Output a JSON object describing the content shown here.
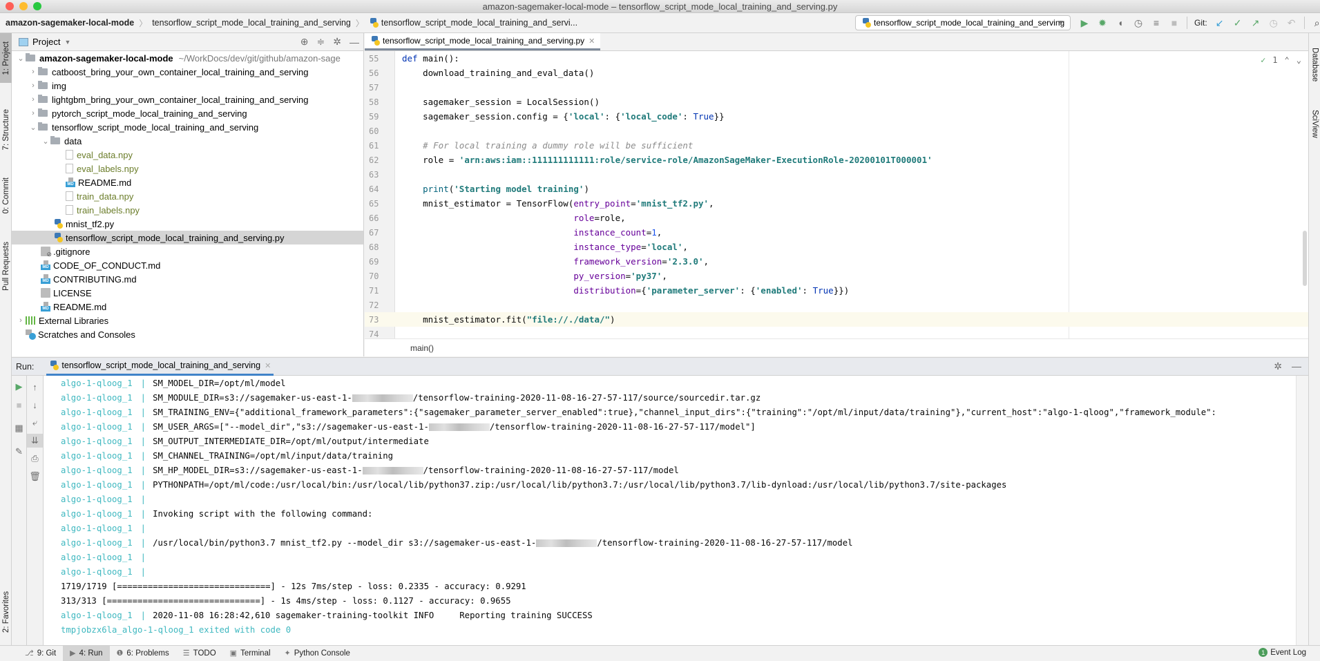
{
  "window": {
    "title": "amazon-sagemaker-local-mode – tensorflow_script_mode_local_training_and_serving.py"
  },
  "navbar": {
    "breadcrumbs": [
      "amazon-sagemaker-local-mode",
      "tensorflow_script_mode_local_training_and_serving",
      "tensorflow_script_mode_local_training_and_servi..."
    ],
    "run_config": "tensorflow_script_mode_local_training_and_serving",
    "git_label": "Git:",
    "icons": [
      "run-icon",
      "debug-icon",
      "coverage-icon",
      "profile-icon",
      "run-with-icon",
      "stop-icon",
      "git-update-icon",
      "git-commit-icon",
      "git-push-icon",
      "git-history-icon",
      "git-rollback-icon",
      "search-icon"
    ]
  },
  "left_strip": {
    "tabs": [
      "1: Project",
      "7: Structure",
      "0: Commit",
      "Pull Requests",
      "2: Favorites"
    ]
  },
  "right_strip": {
    "tabs": [
      "Database",
      "SciView"
    ]
  },
  "project": {
    "title": "Project",
    "root": {
      "name": "amazon-sagemaker-local-mode",
      "path": "~/WorkDocs/dev/git/github/amazon-sage"
    },
    "items": [
      {
        "name": "catboost_bring_your_own_container_local_training_and_serving"
      },
      {
        "name": "img"
      },
      {
        "name": "lightgbm_bring_your_own_container_local_training_and_serving"
      },
      {
        "name": "pytorch_script_mode_local_training_and_serving"
      },
      {
        "name": "tensorflow_script_mode_local_training_and_serving"
      },
      {
        "name": "data"
      },
      {
        "name": "eval_data.npy"
      },
      {
        "name": "eval_labels.npy"
      },
      {
        "name": "README.md"
      },
      {
        "name": "train_data.npy"
      },
      {
        "name": "train_labels.npy"
      },
      {
        "name": "mnist_tf2.py"
      },
      {
        "name": "tensorflow_script_mode_local_training_and_serving.py"
      },
      {
        "name": ".gitignore"
      },
      {
        "name": "CODE_OF_CONDUCT.md"
      },
      {
        "name": "CONTRIBUTING.md"
      },
      {
        "name": "LICENSE"
      },
      {
        "name": "README.md"
      },
      {
        "name": "External Libraries"
      },
      {
        "name": "Scratches and Consoles"
      }
    ]
  },
  "editor": {
    "tab": "tensorflow_script_mode_local_training_and_serving.py",
    "inspection_count": "1",
    "breadcrumb": "main()",
    "lines": [
      {
        "n": "55",
        "t": "def main():"
      },
      {
        "n": "56",
        "t": "    download_training_and_eval_data()"
      },
      {
        "n": "57",
        "t": ""
      },
      {
        "n": "58",
        "t": "    sagemaker_session = LocalSession()"
      },
      {
        "n": "59",
        "t": "    sagemaker_session.config = {'local': {'local_code': True}}"
      },
      {
        "n": "60",
        "t": ""
      },
      {
        "n": "61",
        "t": "    # For local training a dummy role will be sufficient"
      },
      {
        "n": "62",
        "t": "    role = 'arn:aws:iam::111111111111:role/service-role/AmazonSageMaker-ExecutionRole-20200101T000001'"
      },
      {
        "n": "63",
        "t": ""
      },
      {
        "n": "64",
        "t": "    print('Starting model training')"
      },
      {
        "n": "65",
        "t": "    mnist_estimator = TensorFlow(entry_point='mnist_tf2.py',"
      },
      {
        "n": "66",
        "t": "                                 role=role,"
      },
      {
        "n": "67",
        "t": "                                 instance_count=1,"
      },
      {
        "n": "68",
        "t": "                                 instance_type='local',"
      },
      {
        "n": "69",
        "t": "                                 framework_version='2.3.0',"
      },
      {
        "n": "70",
        "t": "                                 py_version='py37',"
      },
      {
        "n": "71",
        "t": "                                 distribution={'parameter_server': {'enabled': True}})"
      },
      {
        "n": "72",
        "t": ""
      },
      {
        "n": "73",
        "t": "    mnist_estimator.fit(\"file://./data/\")"
      },
      {
        "n": "74",
        "t": ""
      }
    ]
  },
  "run": {
    "label": "Run:",
    "tab": "tensorflow_script_mode_local_training_and_serving",
    "host": "algo-1-qloog_1",
    "lines": [
      {
        "host": true,
        "text": "SM_MODEL_DIR=/opt/ml/model"
      },
      {
        "host": true,
        "pre": "SM_MODULE_DIR=s3://sagemaker-us-east-1-",
        "redacted": true,
        "post": "/tensorflow-training-2020-11-08-16-27-57-117/source/sourcedir.tar.gz"
      },
      {
        "host": true,
        "text": "SM_TRAINING_ENV={\"additional_framework_parameters\":{\"sagemaker_parameter_server_enabled\":true},\"channel_input_dirs\":{\"training\":\"/opt/ml/input/data/training\"},\"current_host\":\"algo-1-qloog\",\"framework_module\":"
      },
      {
        "host": true,
        "pre": "SM_USER_ARGS=[\"--model_dir\",\"s3://sagemaker-us-east-1-",
        "redacted": true,
        "post": "/tensorflow-training-2020-11-08-16-27-57-117/model\"]"
      },
      {
        "host": true,
        "text": "SM_OUTPUT_INTERMEDIATE_DIR=/opt/ml/output/intermediate"
      },
      {
        "host": true,
        "text": "SM_CHANNEL_TRAINING=/opt/ml/input/data/training"
      },
      {
        "host": true,
        "pre": "SM_HP_MODEL_DIR=s3://sagemaker-us-east-1-",
        "redacted": true,
        "post": "/tensorflow-training-2020-11-08-16-27-57-117/model"
      },
      {
        "host": true,
        "text": "PYTHONPATH=/opt/ml/code:/usr/local/bin:/usr/local/lib/python37.zip:/usr/local/lib/python3.7:/usr/local/lib/python3.7/lib-dynload:/usr/local/lib/python3.7/site-packages"
      },
      {
        "host": true,
        "text": ""
      },
      {
        "host": true,
        "text": "Invoking script with the following command:"
      },
      {
        "host": true,
        "text": ""
      },
      {
        "host": true,
        "pre": "/usr/local/bin/python3.7 mnist_tf2.py --model_dir s3://sagemaker-us-east-1-",
        "redacted": true,
        "post": "/tensorflow-training-2020-11-08-16-27-57-117/model"
      },
      {
        "host": true,
        "text": ""
      },
      {
        "host": true,
        "text": ""
      },
      {
        "host": false,
        "text": "1719/1719 [==============================] - 12s 7ms/step - loss: 0.2335 - accuracy: 0.9291"
      },
      {
        "host": false,
        "text": "313/313 [==============================] - 1s 4ms/step - loss: 0.1127 - accuracy: 0.9655"
      },
      {
        "host": true,
        "text": "2020-11-08 16:28:42,610 sagemaker-training-toolkit INFO     Reporting training SUCCESS"
      },
      {
        "host": false,
        "exit": true,
        "text": "tmpjobzx6la_algo-1-qloog_1 exited with code 0"
      }
    ]
  },
  "bottom": {
    "tabs": [
      {
        "label": "9: Git",
        "icon": "git-icon"
      },
      {
        "label": "4: Run",
        "icon": "run-icon",
        "active": true
      },
      {
        "label": "6: Problems",
        "icon": "problems-icon"
      },
      {
        "label": "TODO",
        "icon": "todo-icon"
      },
      {
        "label": "Terminal",
        "icon": "terminal-icon"
      },
      {
        "label": "Python Console",
        "icon": "python-console-icon"
      }
    ],
    "event_log": "Event Log",
    "event_count": "1"
  }
}
